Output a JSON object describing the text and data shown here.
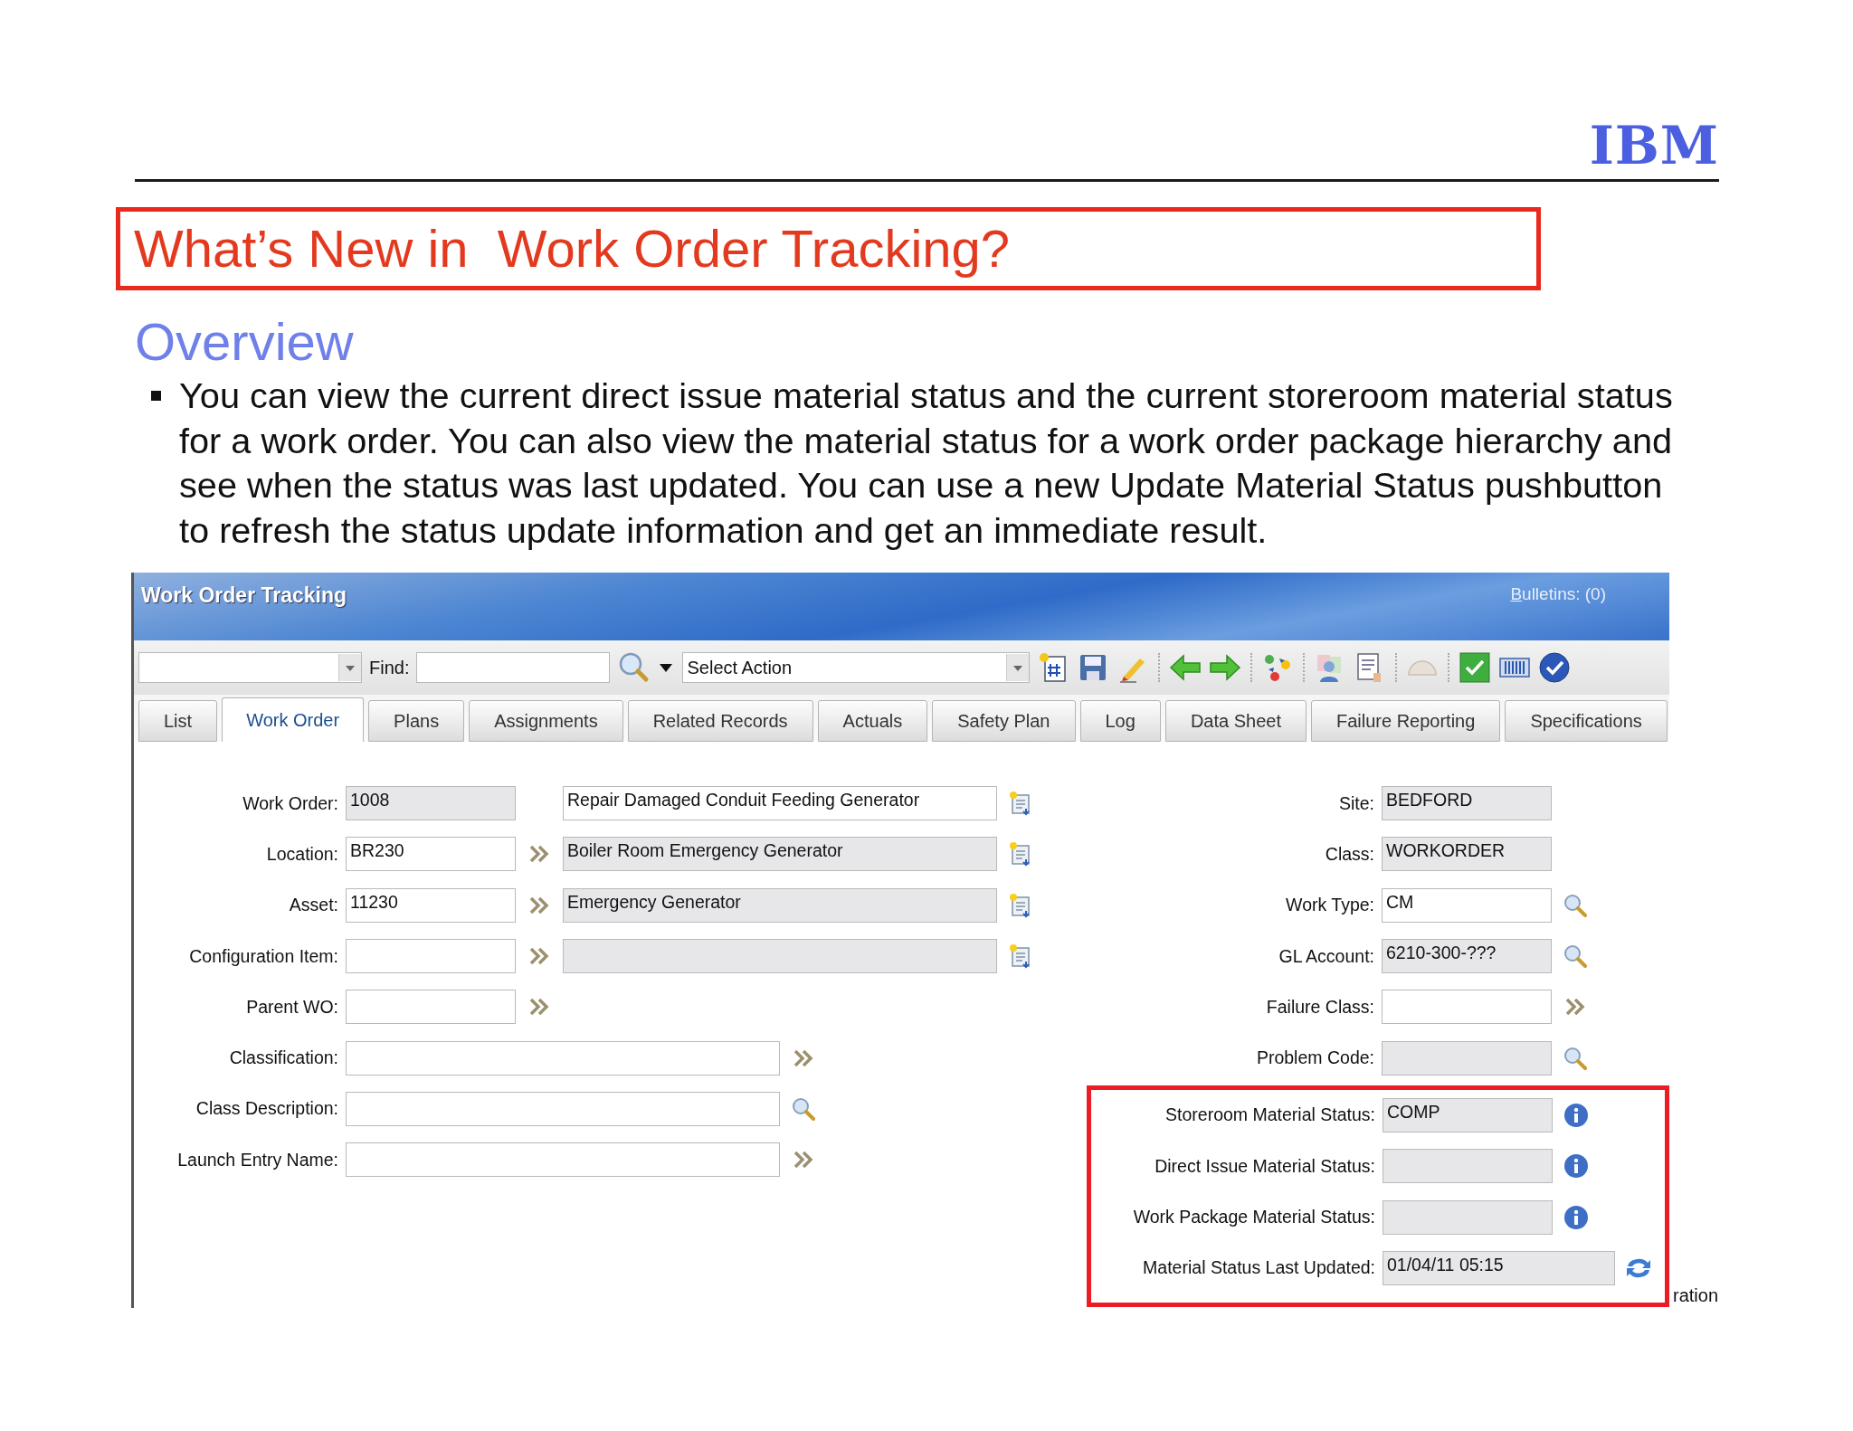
{
  "header": {
    "logo": "IBM"
  },
  "title": "What’s New in  Work Order Tracking?",
  "heading": "Overview",
  "bullets": [
    "You can view the current direct issue material status and the current storeroom material status for a work order. You can also view the material status for a work order package hierarchy and see when the status was last updated. You can use a new Update Material Status pushbutton to refresh the status update information and get an immediate result."
  ],
  "app": {
    "title": "Work Order Tracking",
    "bulletins": "Bulletins: (0)",
    "toolbar": {
      "find_label": "Find:",
      "action_select": "Select Action"
    },
    "tabs": [
      {
        "label": "List",
        "selected": false
      },
      {
        "label": "Work Order",
        "selected": true
      },
      {
        "label": "Plans",
        "selected": false
      },
      {
        "label": "Assignments",
        "selected": false
      },
      {
        "label": "Related Records",
        "selected": false
      },
      {
        "label": "Actuals",
        "selected": false
      },
      {
        "label": "Safety Plan",
        "selected": false
      },
      {
        "label": "Log",
        "selected": false
      },
      {
        "label": "Data Sheet",
        "selected": false
      },
      {
        "label": "Failure Reporting",
        "selected": false
      },
      {
        "label": "Specifications",
        "selected": false
      }
    ],
    "left_rows": [
      {
        "kind": "plain",
        "label": "Work Order:",
        "value": "1008",
        "readonly": true,
        "wide": false,
        "description": {
          "kind": "detail",
          "value": "Repair Damaged Conduit Feeding Generator",
          "readonly": false
        }
      },
      {
        "kind": "lookup",
        "label": "Location:",
        "value": "BR230",
        "readonly": false,
        "wide": false,
        "description": {
          "kind": "detail",
          "value": "Boiler Room Emergency Generator",
          "readonly": true
        }
      },
      {
        "kind": "lookup",
        "label": "Asset:",
        "value": "11230",
        "readonly": false,
        "wide": false,
        "description": {
          "kind": "detail",
          "value": "Emergency Generator",
          "readonly": true
        }
      },
      {
        "kind": "lookup",
        "label": "Configuration Item:",
        "readonly": false,
        "wide": false,
        "description": {
          "kind": "detail",
          "readonly": true
        }
      },
      {
        "kind": "lookup",
        "label": "Parent WO:",
        "readonly": false,
        "wide": false
      },
      {
        "kind": "lookup",
        "label": "Classification:",
        "readonly": false,
        "wide": true
      },
      {
        "kind": "search",
        "label": "Class Description:",
        "readonly": false,
        "wide": true
      },
      {
        "kind": "lookup",
        "label": "Launch Entry Name:",
        "readonly": false,
        "wide": true
      }
    ],
    "right_rows": [
      {
        "kind": "plain",
        "label": "Site:",
        "value": "BEDFORD",
        "readonly": true
      },
      {
        "kind": "plain",
        "label": "Class:",
        "value": "WORKORDER",
        "readonly": true
      },
      {
        "kind": "search",
        "label": "Work Type:",
        "value": "CM",
        "readonly": false
      },
      {
        "kind": "search",
        "label": "GL Account:",
        "value": "6210-300-???",
        "readonly": true
      },
      {
        "kind": "lookup",
        "label": "Failure Class:",
        "readonly": false
      },
      {
        "kind": "search",
        "label": "Problem Code:",
        "readonly": true
      }
    ],
    "highlighted_rows": [
      {
        "kind": "info",
        "label": "Storeroom Material Status:",
        "value": "COMP",
        "readonly": true
      },
      {
        "kind": "info",
        "label": "Direct Issue Material Status:",
        "readonly": true
      },
      {
        "kind": "info",
        "label": "Work Package Material Status:",
        "readonly": true
      },
      {
        "kind": "refresh",
        "label": "Material Status Last Updated:",
        "value": "01/04/11 05:15",
        "readonly": true
      }
    ]
  },
  "footer_fragment": "ration"
}
